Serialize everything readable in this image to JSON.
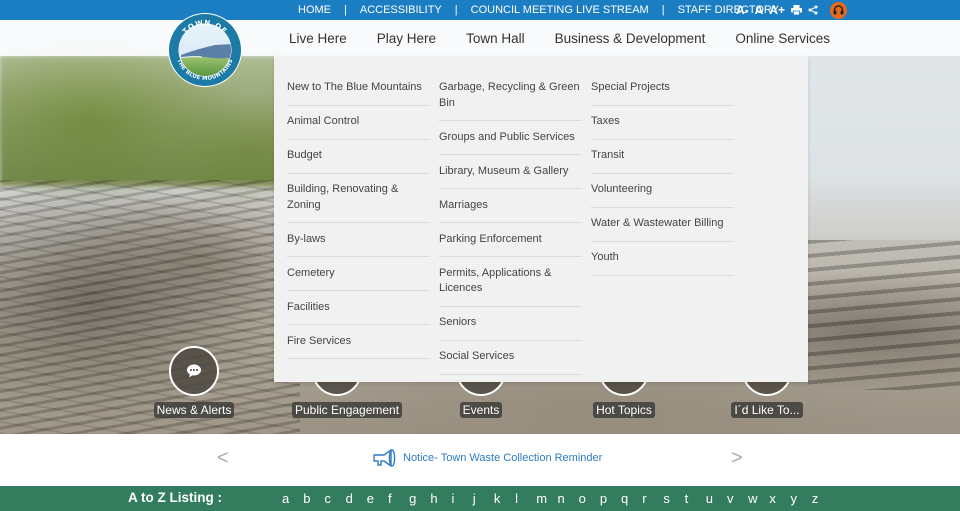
{
  "utility": {
    "links": [
      "HOME",
      "ACCESSIBILITY",
      "COUNCIL MEETING LIVE STREAM",
      "STAFF DIRECTORY"
    ],
    "separator": "|",
    "tools": {
      "decrease_text": "A-",
      "normal_text": "A",
      "increase_text": "A+"
    },
    "colors": {
      "bar": "#1c7ec2",
      "avatar": "#e8681c"
    }
  },
  "logo": {
    "top_text": "TOWN OF",
    "bottom_text": "THE BLUE MOUNTAINS"
  },
  "nav": {
    "items": [
      "Live Here",
      "Play Here",
      "Town Hall",
      "Business & Development",
      "Online Services"
    ],
    "active": "Live Here"
  },
  "mega_menu": {
    "columns": [
      [
        "New to The Blue Mountains",
        "Animal Control",
        "Budget",
        "Building, Renovating & Zoning",
        "By-laws",
        "Cemetery",
        "Facilities",
        "Fire Services"
      ],
      [
        "Garbage, Recycling & Green Bin",
        "Groups and Public Services",
        "Library, Museum & Gallery",
        "Marriages",
        "Parking Enforcement",
        "Permits, Applications & Licences",
        "Seniors",
        "Social Services"
      ],
      [
        "Special Projects",
        "Taxes",
        "Transit",
        "Volunteering",
        "Water & Wastewater Billing",
        "Youth"
      ]
    ]
  },
  "quick_links": [
    {
      "label": "News & Alerts",
      "icon": "chat-bubble-icon"
    },
    {
      "label": "Public Engagement",
      "icon": "engagement-icon"
    },
    {
      "label": "Events",
      "icon": "calendar-icon"
    },
    {
      "label": "Hot Topics",
      "icon": "fire-icon"
    },
    {
      "label": "I´d Like To...",
      "icon": "hand-pointer-icon"
    }
  ],
  "notice": {
    "prev": "<",
    "next": ">",
    "text": "Notice- Town Waste Collection Reminder",
    "color": "#2d7bc3"
  },
  "az": {
    "title": "A to Z Listing :",
    "letters": [
      "a",
      "b",
      "c",
      "d",
      "e",
      "f",
      "g",
      "h",
      "i",
      "j",
      "k",
      "l",
      "m",
      "n",
      "o",
      "p",
      "q",
      "r",
      "s",
      "t",
      "u",
      "v",
      "w",
      "x",
      "y",
      "z"
    ],
    "color": "#337c5e"
  }
}
